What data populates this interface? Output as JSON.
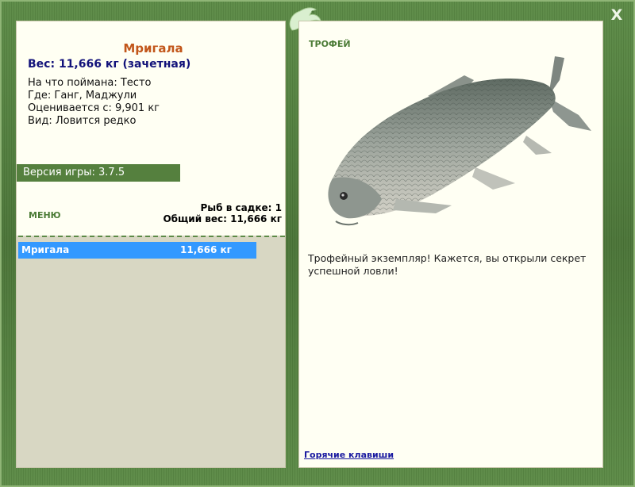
{
  "window": {
    "close_label": "X"
  },
  "fish": {
    "name": "Мригала",
    "weight_line": "Вес: 11,666 кг (зачетная)",
    "bait": "На что поймана: Тесто",
    "location": "Где: Ганг, Маджули",
    "valued": "Оценивается с: 9,901 кг",
    "species": "Вид: Ловится редко"
  },
  "version": "Версия игры: 3.7.5",
  "menu": {
    "label": "МЕНЮ"
  },
  "keepnet": {
    "count": "Рыб в садке: 1",
    "total": "Общий вес: 11,666 кг",
    "items": [
      {
        "name": "Мригала",
        "weight": "11,666 кг"
      }
    ]
  },
  "trophy": {
    "label": "ТРОФЕЙ",
    "text": "Трофейный экземпляр! Кажется, вы открыли секрет успешной ловли!"
  },
  "hotkeys_label": "Горячие клавиши",
  "colors": {
    "frame": "#4f7a3c",
    "panel": "#fffff3",
    "accent": "#55803e",
    "selection": "#3399ff",
    "title": "#c2561a"
  },
  "icons": {
    "close": "close-icon",
    "logo": "fish-logo-icon",
    "fish": "fish-image"
  }
}
